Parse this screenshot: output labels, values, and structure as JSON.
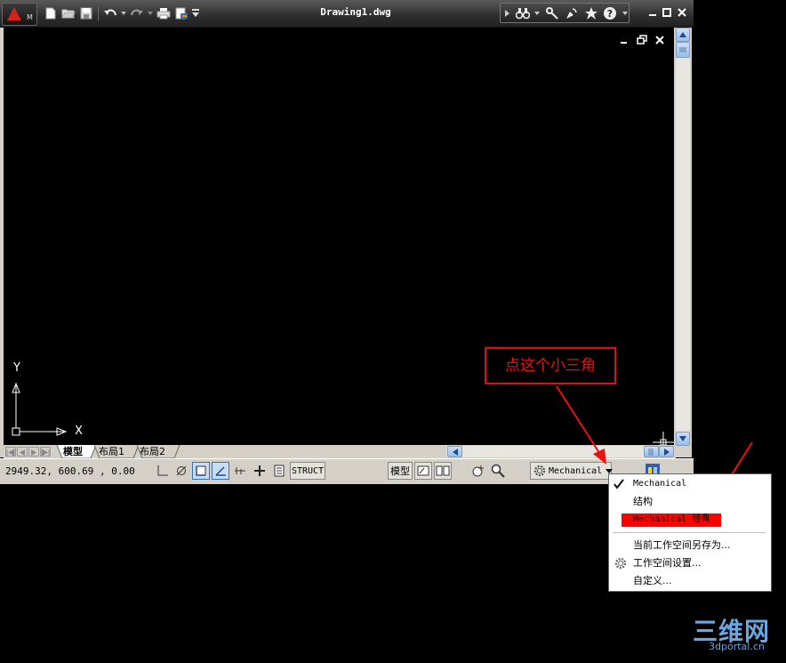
{
  "app": {
    "title": "Drawing1.dwg",
    "app_logo_letter": "M"
  },
  "canvas": {
    "ucs_y_label": "Y",
    "ucs_x_label": "X"
  },
  "tabs": [
    {
      "label": "模型",
      "active": true
    },
    {
      "label": "布局1",
      "active": false
    },
    {
      "label": "布局2",
      "active": false
    }
  ],
  "statusbar": {
    "coordinates": "2949.32, 600.69 , 0.00",
    "struct_label": "STRUCT",
    "model_label": "模型",
    "workspace_label": "Mechanical"
  },
  "workspace_menu": {
    "items": [
      {
        "label": "Mechanical",
        "checked": true
      },
      {
        "label": "结构",
        "checked": false
      },
      {
        "label": "Mechanical 经典",
        "checked": false,
        "highlighted": true
      },
      {
        "label": "当前工作空间另存为...",
        "checked": false
      },
      {
        "label": "工作空间设置...",
        "checked": false,
        "icon": "gear-icon"
      },
      {
        "label": "自定义...",
        "checked": false
      }
    ]
  },
  "annotation": {
    "text": "点这个小三角",
    "color": "#dd1111"
  },
  "watermark": {
    "brand": "三维网",
    "url": "3dportal.cn"
  },
  "colors": {
    "canvas_bg": "#000000",
    "title_bar": "#2e2e2e",
    "menu_highlight": "#ff0000",
    "scroll_blue": "#9cbde6"
  }
}
